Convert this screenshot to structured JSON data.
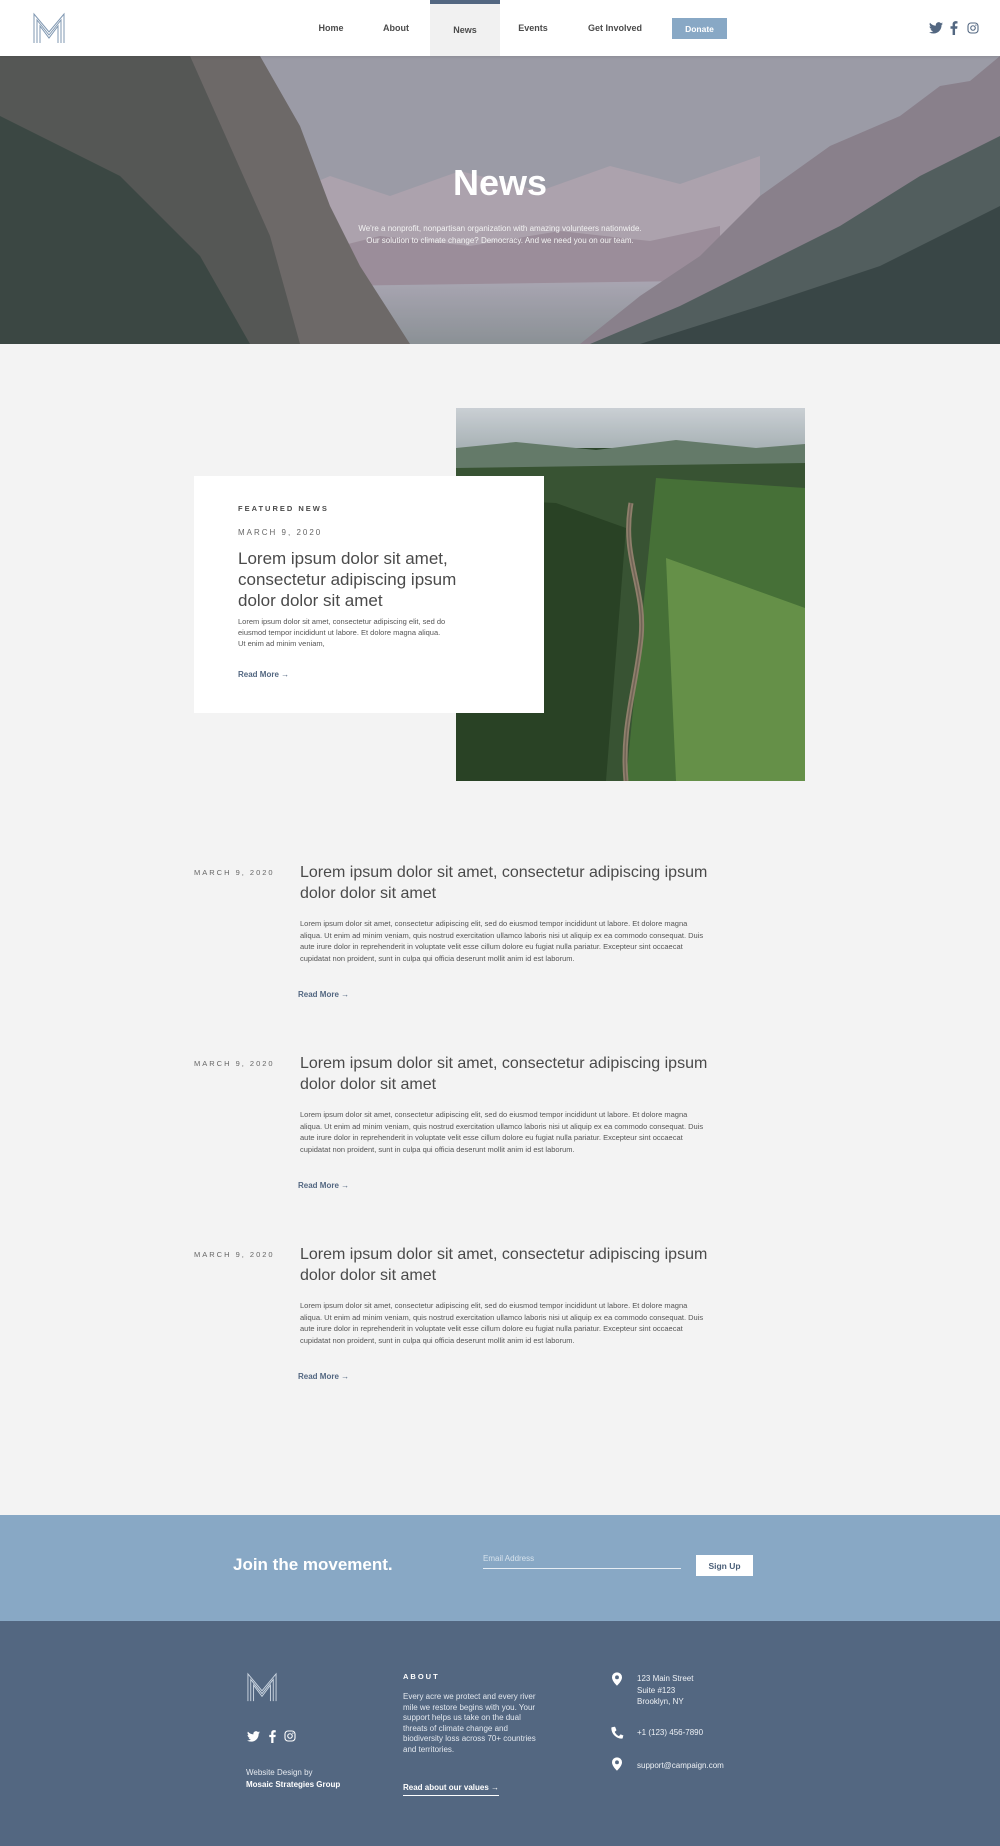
{
  "nav": {
    "logo": "M",
    "items": [
      {
        "label": "Home"
      },
      {
        "label": "About"
      },
      {
        "label": "News",
        "active": true
      },
      {
        "label": "Events"
      },
      {
        "label": "Get Involved"
      }
    ],
    "donate_label": "Donate",
    "social": [
      "twitter-icon",
      "facebook-icon",
      "instagram-icon"
    ]
  },
  "hero": {
    "title": "News",
    "subtitle_line1": "We're a nonprofit, nonpartisan organization with amazing volunteers nationwide.",
    "subtitle_line2": "Our solution to climate change? Democracy. And we need you on our team."
  },
  "featured": {
    "label": "FEATURED NEWS",
    "date": "MARCH 9, 2020",
    "title": "Lorem ipsum dolor sit amet, consectetur adipiscing ipsum dolor dolor sit amet",
    "body": "Lorem ipsum dolor sit amet, consectetur adipiscing elit, sed do eiusmod tempor incididunt ut labore. Et dolore magna aliqua. Ut enim ad minim veniam,",
    "read_more": "Read More →"
  },
  "articles": [
    {
      "date": "MARCH 9, 2020",
      "title": "Lorem ipsum dolor sit amet, consectetur adipiscing ipsum dolor dolor sit amet",
      "body": "Lorem ipsum dolor sit amet, consectetur adipiscing elit, sed do eiusmod tempor incididunt ut labore. Et dolore magna aliqua. Ut enim ad minim veniam, quis nostrud exercitation ullamco laboris nisi ut aliquip ex ea commodo consequat. Duis aute irure dolor in reprehenderit in voluptate velit esse cillum dolore eu fugiat nulla pariatur. Excepteur sint occaecat cupidatat non proident, sunt in culpa qui officia deserunt mollit anim id est laborum.",
      "read_more": "Read More →"
    },
    {
      "date": "MARCH 9, 2020",
      "title": "Lorem ipsum dolor sit amet, consectetur adipiscing ipsum dolor dolor sit amet",
      "body": "Lorem ipsum dolor sit amet, consectetur adipiscing elit, sed do eiusmod tempor incididunt ut labore. Et dolore magna aliqua. Ut enim ad minim veniam, quis nostrud exercitation ullamco laboris nisi ut aliquip ex ea commodo consequat. Duis aute irure dolor in reprehenderit in voluptate velit esse cillum dolore eu fugiat nulla pariatur. Excepteur sint occaecat cupidatat non proident, sunt in culpa qui officia deserunt mollit anim id est laborum.",
      "read_more": "Read More →"
    },
    {
      "date": "MARCH 9, 2020",
      "title": "Lorem ipsum dolor sit amet, consectetur adipiscing ipsum dolor dolor sit amet",
      "body": "Lorem ipsum dolor sit amet, consectetur adipiscing elit, sed do eiusmod tempor incididunt ut labore. Et dolore magna aliqua. Ut enim ad minim veniam, quis nostrud exercitation ullamco laboris nisi ut aliquip ex ea commodo consequat. Duis aute irure dolor in reprehenderit in voluptate velit esse cillum dolore eu fugiat nulla pariatur. Excepteur sint occaecat cupidatat non proident, sunt in culpa qui officia deserunt mollit anim id est laborum.",
      "read_more": "Read More →"
    }
  ],
  "join": {
    "title": "Join the movement.",
    "email_placeholder": "Email Address",
    "signup_label": "Sign Up"
  },
  "footer": {
    "social": [
      "twitter-icon",
      "facebook-icon",
      "instagram-icon"
    ],
    "credit_line1": "Website Design by",
    "credit_line2": "Mosaic Strategies Group",
    "about_label": "ABOUT",
    "about_text": "Every acre we protect and every river mile we restore begins with you. Your support helps us take on the dual threats of climate change and biodiversity loss across 70+ countries and territories.",
    "about_link": "Read about our values →",
    "address": [
      "123 Main Street",
      "Suite #123",
      "Brooklyn, NY"
    ],
    "phone": "+1 (123) 456-7890",
    "email": "support@campaign.com"
  },
  "colors": {
    "accent": "#88a8c5",
    "footer": "#536781",
    "background": "#f3f3f3",
    "nav_active": "#536781"
  }
}
